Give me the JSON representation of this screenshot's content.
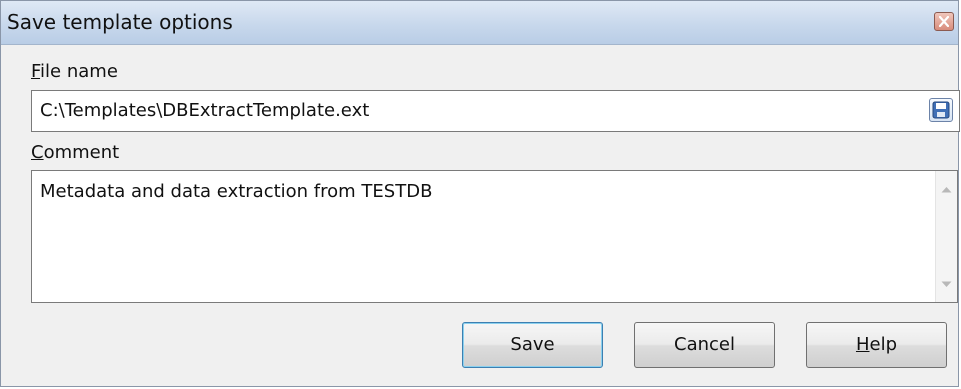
{
  "window": {
    "title": "Save template options"
  },
  "file_name": {
    "label_underlined": "F",
    "label_rest": "ile name",
    "value": "C:\\Templates\\DBExtractTemplate.ext"
  },
  "comment": {
    "label_underlined": "C",
    "label_rest": "omment",
    "value": "Metadata and data extraction from TESTDB"
  },
  "buttons": {
    "save": "Save",
    "cancel": "Cancel",
    "help_underlined": "H",
    "help_rest": "elp"
  },
  "icons": {
    "close": "close-icon",
    "save_file": "floppy-disk-icon",
    "scroll_up": "scroll-up-arrow-icon",
    "scroll_down": "scroll-down-arrow-icon"
  },
  "colors": {
    "titlebar": "#c8d8ec",
    "dialog_bg": "#f0f0f0",
    "default_button_border": "#3c7fb1"
  }
}
